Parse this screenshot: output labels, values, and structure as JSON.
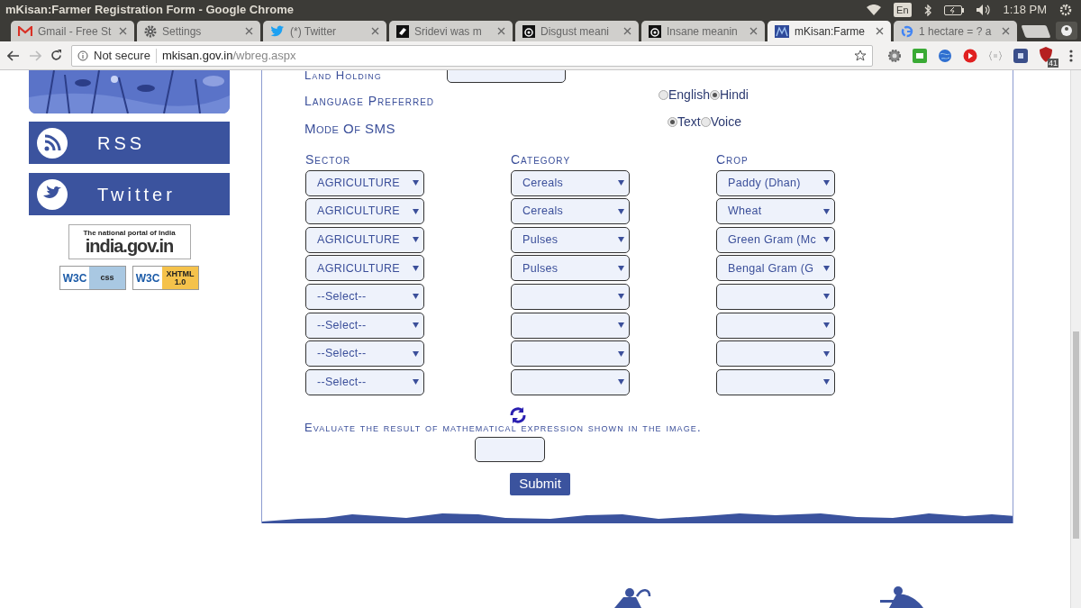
{
  "os_bar": {
    "window_title": "mKisan:Farmer Registration Form - Google Chrome",
    "language": "En",
    "time": "1:18 PM"
  },
  "tabs": [
    {
      "title": "Gmail - Free St",
      "kind": "gmail",
      "selected": false
    },
    {
      "title": "Settings",
      "kind": "settings",
      "selected": false
    },
    {
      "title": "(*) Twitter",
      "kind": "twitter",
      "selected": false
    },
    {
      "title": "Sridevi was m",
      "kind": "book",
      "selected": false
    },
    {
      "title": "Disgust meani",
      "kind": "ring",
      "selected": false
    },
    {
      "title": "Insane meanin",
      "kind": "ring",
      "selected": false
    },
    {
      "title": "mKisan:Farme",
      "kind": "site",
      "selected": true
    },
    {
      "title": "1 hectare = ? a",
      "kind": "google",
      "selected": false
    }
  ],
  "address_bar": {
    "security": "Not secure",
    "host": "mkisan.gov.in",
    "path": "/wbreg.aspx",
    "extension_badge": "41"
  },
  "sidebar": {
    "links": [
      {
        "label": "RSS",
        "kind": "rss"
      },
      {
        "label": "Twitter",
        "kind": "twitter"
      }
    ],
    "portal_badge": {
      "tagline": "The national portal of India",
      "name": "india.gov.in"
    },
    "validators": [
      {
        "logo": "W3C",
        "label": "css",
        "kind": "css"
      },
      {
        "logo": "W3C",
        "label": "XHTML",
        "version": "1.0",
        "kind": "xhtml"
      }
    ]
  },
  "form": {
    "land_holding": {
      "label": "Land Holding"
    },
    "language": {
      "label": "Language Preferred",
      "options": [
        {
          "label": "English",
          "selected": false
        },
        {
          "label": "Hindi",
          "selected": true
        }
      ]
    },
    "sms_mode": {
      "label": "Mode Of SMS",
      "options": [
        {
          "label": "Text",
          "selected": true
        },
        {
          "label": "Voice",
          "selected": false
        }
      ]
    },
    "crop_table": {
      "columns": [
        "Sector",
        "Category",
        "Crop"
      ],
      "rows": [
        {
          "sector": "AGRICULTURE",
          "category": "Cereals",
          "crop": "Paddy (Dhan)"
        },
        {
          "sector": "AGRICULTURE",
          "category": "Cereals",
          "crop": "Wheat"
        },
        {
          "sector": "AGRICULTURE",
          "category": "Pulses",
          "crop": "Green Gram (Mc"
        },
        {
          "sector": "AGRICULTURE",
          "category": "Pulses",
          "crop": "Bengal Gram (G"
        },
        {
          "sector": "--Select--"
        },
        {
          "sector": "--Select--"
        },
        {
          "sector": "--Select--"
        },
        {
          "sector": "--Select--"
        }
      ]
    },
    "captcha": {
      "prompt": "Evaluate the result of mathematical expression shown in the image."
    },
    "submit": "Submit"
  }
}
